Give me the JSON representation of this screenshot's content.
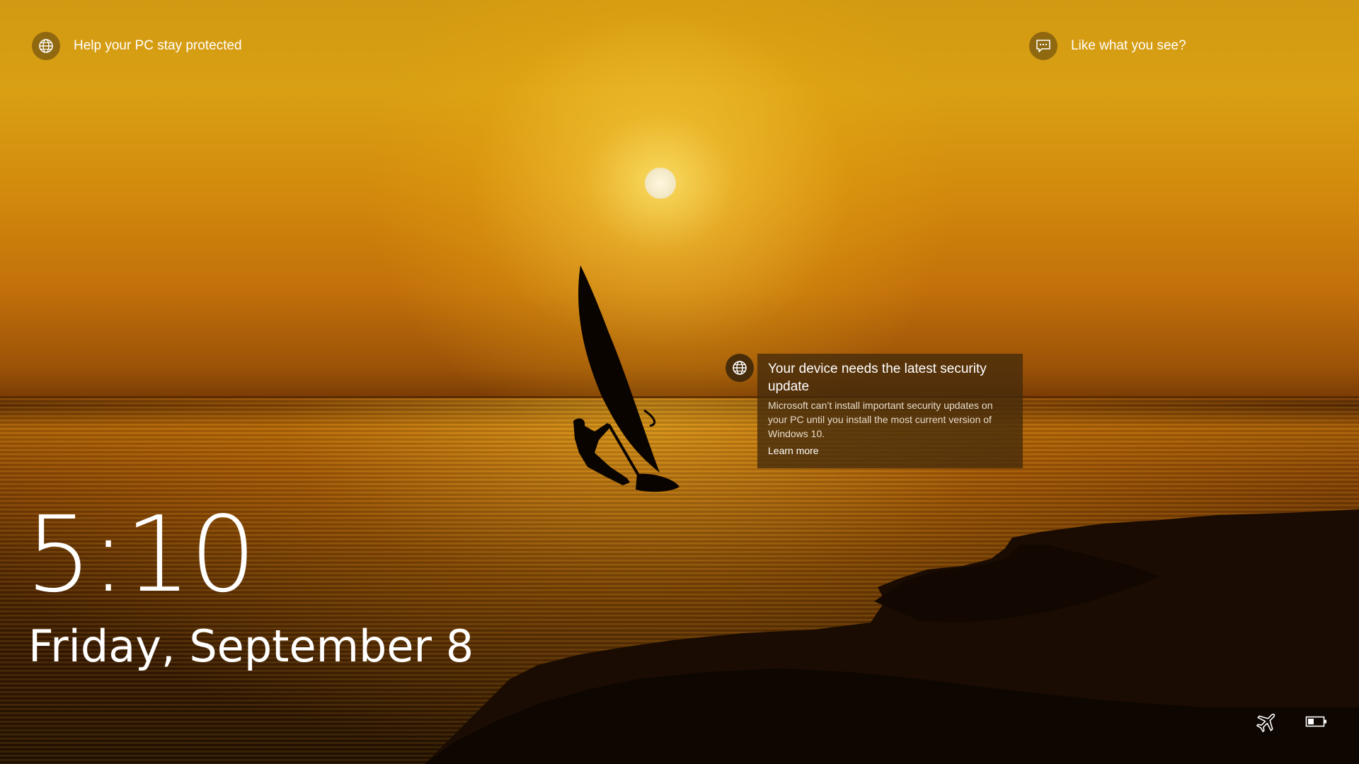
{
  "top_left": {
    "icon": "globe-icon",
    "label": "Help your PC stay protected"
  },
  "top_right": {
    "icon": "chat-icon",
    "label": "Like what you see?"
  },
  "notification": {
    "icon": "globe-icon",
    "title": "Your device needs the latest security update",
    "body": "Microsoft can’t install important security updates on your PC until you install the most current version of Windows 10.",
    "link": "Learn more"
  },
  "clock": {
    "time": "5:10",
    "date": "Friday, September 8"
  },
  "status": {
    "icons": [
      "airplane-mode-icon",
      "battery-icon"
    ],
    "battery_level": 0.4
  },
  "colors": {
    "sky_top": "#d29a12",
    "sun_glow": "#ffe86e",
    "notification_bg": "#442a0c",
    "text": "#ffffff"
  }
}
